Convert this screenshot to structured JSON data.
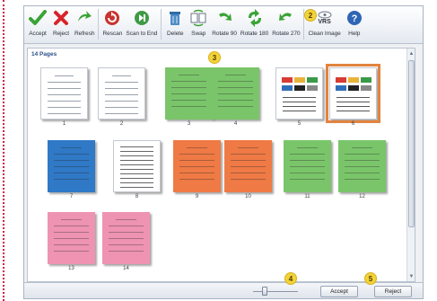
{
  "toolbar": {
    "buttons": [
      {
        "label": "Accept",
        "icon": "check-icon"
      },
      {
        "label": "Reject",
        "icon": "x-icon"
      },
      {
        "label": "Refresh",
        "icon": "refresh-icon"
      },
      {
        "label": "Rescan",
        "icon": "rescan-icon"
      },
      {
        "label": "Scan to End",
        "icon": "scan-to-end-icon"
      },
      {
        "label": "Delete",
        "icon": "trash-icon"
      },
      {
        "label": "Swap",
        "icon": "swap-icon"
      },
      {
        "label": "Rotate 90",
        "icon": "rotate-90-icon"
      },
      {
        "label": "Rotate 180",
        "icon": "rotate-180-icon"
      },
      {
        "label": "Rotate 270",
        "icon": "rotate-270-icon"
      },
      {
        "label": "Clean Image",
        "icon": "vrs-clean-image-icon",
        "badge": "VRS"
      },
      {
        "label": "Help",
        "icon": "help-icon"
      }
    ]
  },
  "callouts": {
    "c2": "2",
    "c3": "3",
    "c4": "4",
    "c5": "5"
  },
  "pages": {
    "title": "14 Pages",
    "items": [
      {
        "num": "1",
        "color": "#ffffff",
        "style": "form"
      },
      {
        "num": "2",
        "color": "#ffffff",
        "style": "form"
      },
      {
        "num": "3",
        "color": "#7ac56a",
        "style": "text"
      },
      {
        "num": "4",
        "color": "#7ac56a",
        "style": "text"
      },
      {
        "num": "5",
        "color": "#ffffff",
        "style": "colortest"
      },
      {
        "num": "6",
        "color": "#ffffff",
        "style": "colortest",
        "selected": true
      },
      {
        "num": "7",
        "color": "#2f79c6",
        "style": "text"
      },
      {
        "num": "8",
        "color": "#ffffff",
        "style": "table"
      },
      {
        "num": "9",
        "color": "#ef7a45",
        "style": "text"
      },
      {
        "num": "10",
        "color": "#ef7a45",
        "style": "text"
      },
      {
        "num": "11",
        "color": "#7ac56a",
        "style": "text"
      },
      {
        "num": "12",
        "color": "#7ac56a",
        "style": "text"
      },
      {
        "num": "13",
        "color": "#ee93b1",
        "style": "text"
      },
      {
        "num": "14",
        "color": "#ee93b1",
        "style": "text"
      }
    ]
  },
  "statusbar": {
    "zoom_level": 0.25,
    "accept_label": "Accept",
    "reject_label": "Reject"
  }
}
